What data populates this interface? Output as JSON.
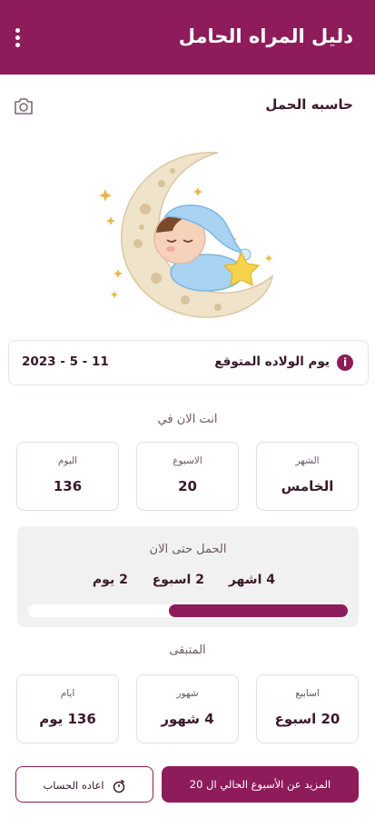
{
  "app_bar": {
    "title": "دليل المراه الحامل",
    "menu_icon": "more-vert-icon"
  },
  "calculator": {
    "title": "حاسبه الحمل",
    "camera_icon": "camera-icon"
  },
  "due_date": {
    "label": "يوم الولاده المتوقع",
    "value": "2023 - 5 - 11",
    "icon": "info-icon"
  },
  "now": {
    "heading": "انت الان في",
    "month": {
      "label": "الشهر",
      "value": "الخامس"
    },
    "week": {
      "label": "الاسبوع",
      "value": "20"
    },
    "day": {
      "label": "اليوم",
      "value": "136"
    }
  },
  "progress": {
    "title": "الحمل حتى الان",
    "months": "4 اشهر",
    "weeks": "2 اسبوع",
    "days": "2 يوم",
    "fraction": 0.56
  },
  "remaining": {
    "heading": "المتبقى",
    "weeks": {
      "label": "اسابيع",
      "value": "20 اسبوع"
    },
    "months": {
      "label": "شهور",
      "value": "4 شهور"
    },
    "days": {
      "label": "ايام",
      "value": "136 يوم"
    }
  },
  "actions": {
    "more_label": "المزيد عن الأسبوع الحالي ال 20",
    "reset_label": "اعاده الحساب",
    "reset_icon": "reset-timer-icon"
  },
  "colors": {
    "primary": "#8e1c5a",
    "panel": "#f1f1f1"
  }
}
